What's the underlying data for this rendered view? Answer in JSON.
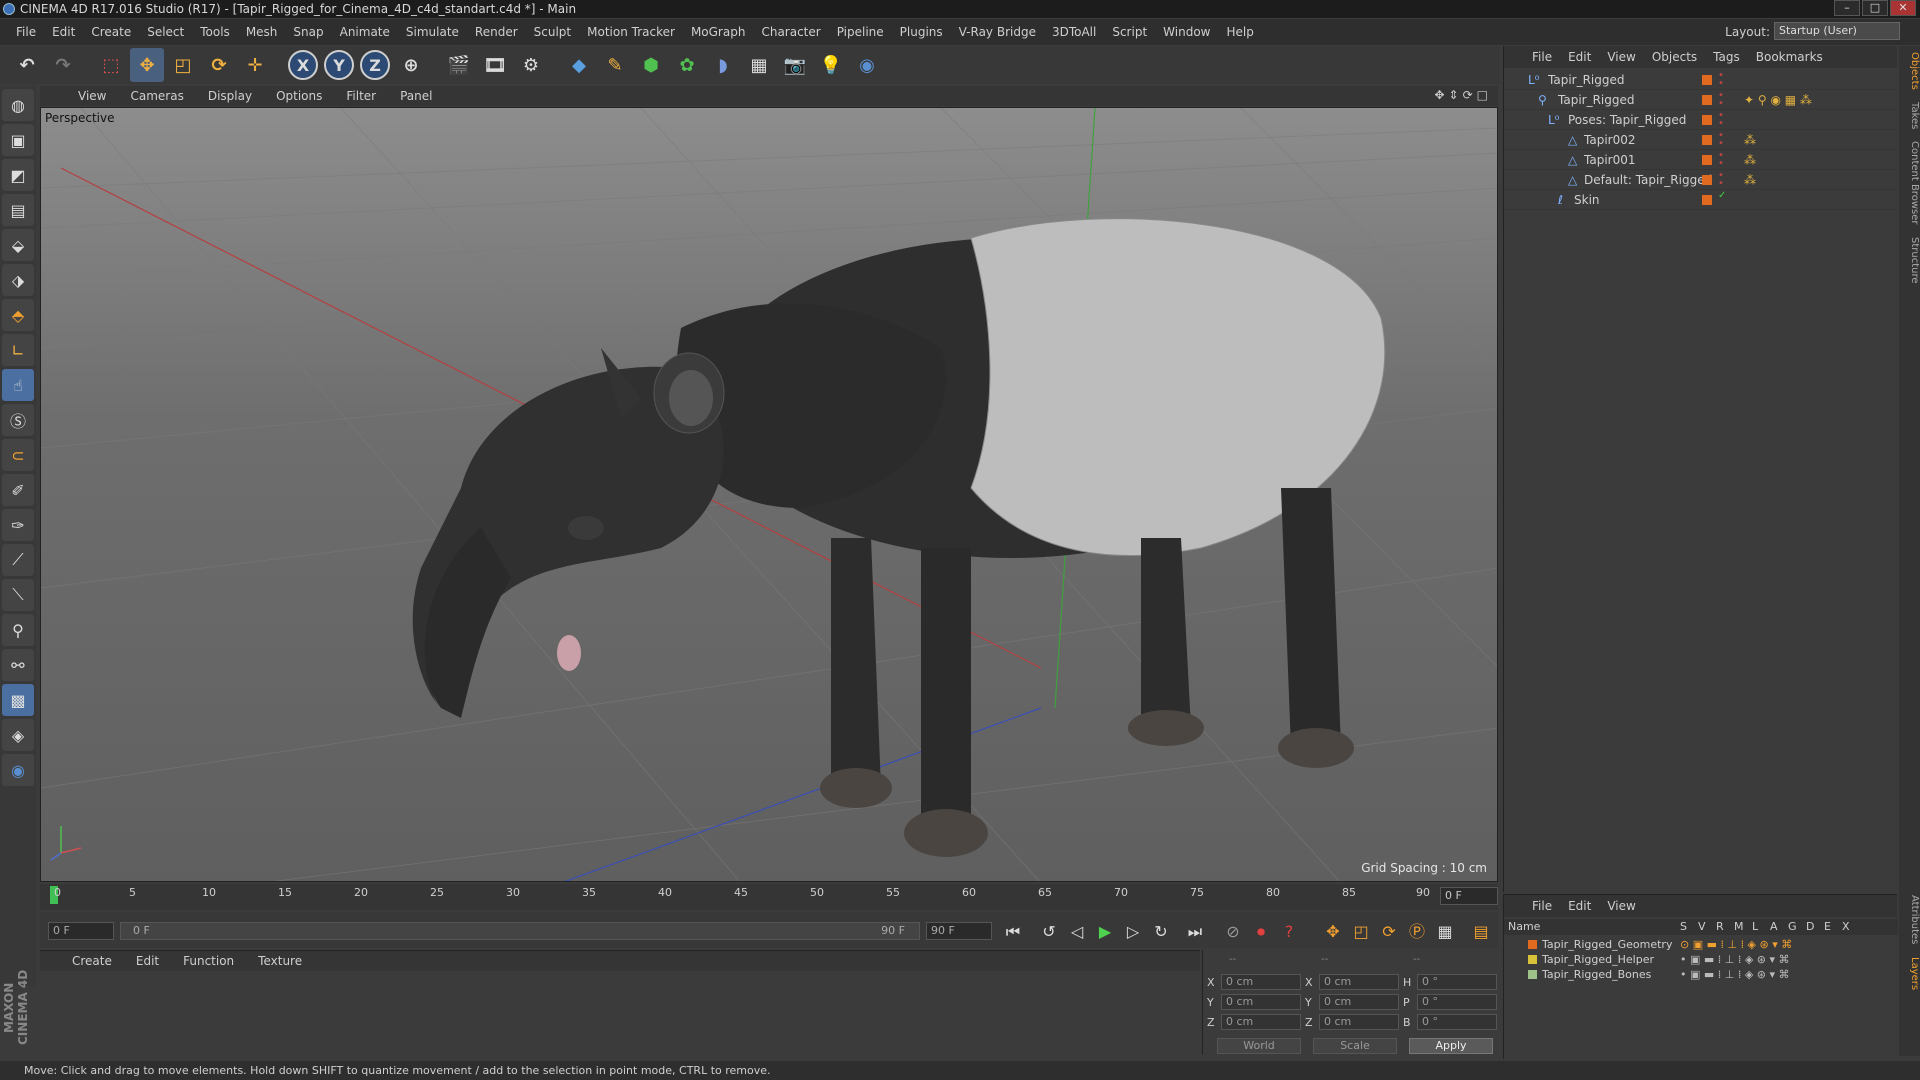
{
  "window": {
    "title": "CINEMA 4D R17.016 Studio (R17) - [Tapir_Rigged_for_Cinema_4D_c4d_standart.c4d *] - Main"
  },
  "menubar": [
    "File",
    "Edit",
    "Create",
    "Select",
    "Tools",
    "Mesh",
    "Snap",
    "Animate",
    "Simulate",
    "Render",
    "Sculpt",
    "Motion Tracker",
    "MoGraph",
    "Character",
    "Pipeline",
    "Plugins",
    "V-Ray Bridge",
    "3DToAll",
    "Script",
    "Window",
    "Help"
  ],
  "layout": {
    "label": "Layout:",
    "value": "Startup (User)"
  },
  "toolbar": {
    "axis_x": "X",
    "axis_y": "Y",
    "axis_z": "Z"
  },
  "viewport": {
    "menu": [
      "View",
      "Cameras",
      "Display",
      "Options",
      "Filter",
      "Panel"
    ],
    "label": "Perspective",
    "grid_spacing": "Grid Spacing : 10 cm"
  },
  "timeline": {
    "ticks": [
      "0",
      "5",
      "10",
      "15",
      "20",
      "25",
      "30",
      "35",
      "40",
      "45",
      "50",
      "55",
      "60",
      "65",
      "70",
      "75",
      "80",
      "85",
      "90"
    ],
    "current_frame": "0 F"
  },
  "transport": {
    "start_field": "0 F",
    "range_start": "0 F",
    "range_end": "90 F",
    "end_field": "90 F"
  },
  "material_menu": [
    "Create",
    "Edit",
    "Function",
    "Texture"
  ],
  "coords": {
    "col_headers": [
      "--",
      "--",
      "--"
    ],
    "rows": [
      {
        "l1": "X",
        "v1": "0 cm",
        "l2": "X",
        "v2": "0 cm",
        "l3": "H",
        "v3": "0 °"
      },
      {
        "l1": "Y",
        "v1": "0 cm",
        "l2": "Y",
        "v2": "0 cm",
        "l3": "P",
        "v3": "0 °"
      },
      {
        "l1": "Z",
        "v1": "0 cm",
        "l2": "Z",
        "v2": "0 cm",
        "l3": "B",
        "v3": "0 °"
      }
    ],
    "mode_world": "World",
    "mode_scale": "Scale",
    "apply": "Apply"
  },
  "status": "Move: Click and drag to move elements. Hold down SHIFT to quantize movement / add to the selection in point mode, CTRL to remove.",
  "objects": {
    "menu": [
      "File",
      "Edit",
      "View",
      "Objects",
      "Tags",
      "Bookmarks"
    ],
    "items": [
      {
        "name": "Tapir_Rigged",
        "indent": 0
      },
      {
        "name": "Tapir_Rigged",
        "indent": 1
      },
      {
        "name": "Poses: Tapir_Rigged",
        "indent": 2
      },
      {
        "name": "Tapir002",
        "indent": 3
      },
      {
        "name": "Tapir001",
        "indent": 3
      },
      {
        "name": "Default: Tapir_Rigged",
        "indent": 3
      },
      {
        "name": "Skin",
        "indent": 2
      }
    ]
  },
  "layers": {
    "menu": [
      "File",
      "Edit",
      "View"
    ],
    "header": {
      "name": "Name",
      "cols": [
        "S",
        "V",
        "R",
        "M",
        "L",
        "A",
        "G",
        "D",
        "E",
        "X"
      ]
    },
    "items": [
      {
        "name": "Tapir_Rigged_Geometry",
        "color": "#e06a1f"
      },
      {
        "name": "Tapir_Rigged_Helper",
        "color": "#d8c23a"
      },
      {
        "name": "Tapir_Rigged_Bones",
        "color": "#9fc28a"
      }
    ]
  },
  "sidetabs": [
    "Objects",
    "Takes",
    "Content Browser",
    "Structure",
    "Attributes",
    "Layers"
  ],
  "branding": "MAXON CINEMA 4D"
}
